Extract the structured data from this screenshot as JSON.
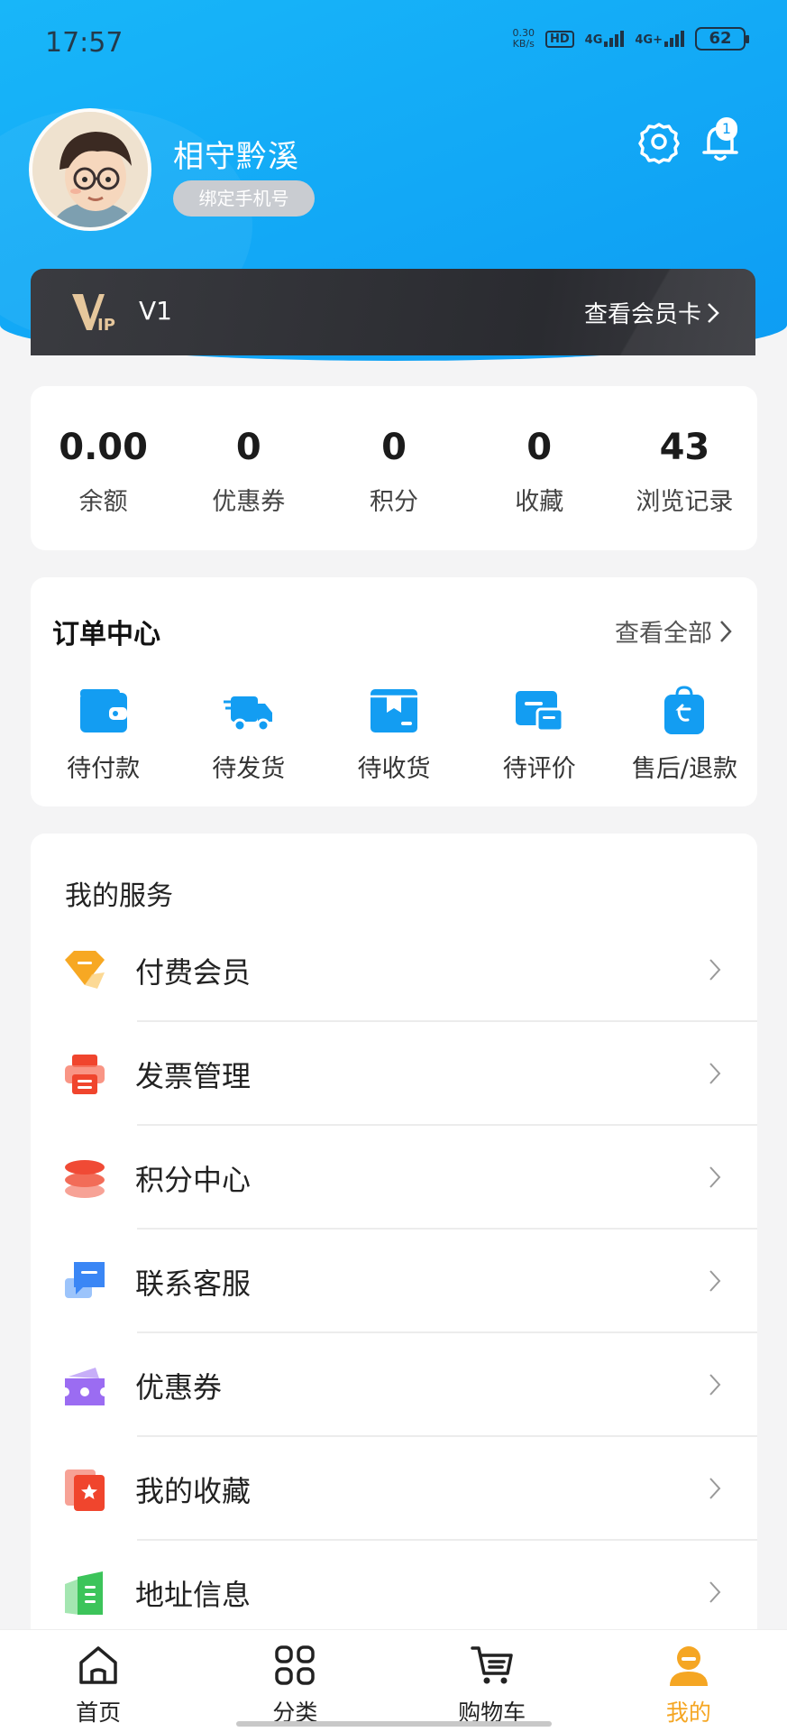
{
  "status_bar": {
    "time": "17:57",
    "net_speed_value": "0.30",
    "net_speed_unit": "KB/s",
    "hd_label": "HD",
    "signal1_label": "4G",
    "signal2_label": "4G+",
    "battery": "62"
  },
  "profile": {
    "name": "相守黔溪",
    "bind_phone_label": "绑定手机号",
    "notification_count": "1"
  },
  "vip": {
    "level": "V1",
    "link_label": "查看会员卡"
  },
  "stats": [
    {
      "value": "0.00",
      "label": "余额"
    },
    {
      "value": "0",
      "label": "优惠券"
    },
    {
      "value": "0",
      "label": "积分"
    },
    {
      "value": "0",
      "label": "收藏"
    },
    {
      "value": "43",
      "label": "浏览记录"
    }
  ],
  "orders": {
    "title": "订单中心",
    "view_all_label": "查看全部",
    "items": [
      {
        "label": "待付款",
        "icon": "wallet-icon"
      },
      {
        "label": "待发货",
        "icon": "delivery-truck-icon"
      },
      {
        "label": "待收货",
        "icon": "package-box-icon"
      },
      {
        "label": "待评价",
        "icon": "review-chat-icon"
      },
      {
        "label": "售后/退款",
        "icon": "return-bag-icon"
      }
    ]
  },
  "services": {
    "title": "我的服务",
    "items": [
      {
        "label": "付费会员",
        "icon": "diamond-icon",
        "color": "#f7a823"
      },
      {
        "label": "发票管理",
        "icon": "invoice-printer-icon",
        "color": "#f0452d"
      },
      {
        "label": "积分中心",
        "icon": "coin-stack-icon",
        "color": "#f04a35"
      },
      {
        "label": "联系客服",
        "icon": "chat-bubble-icon",
        "color": "#3a86f5"
      },
      {
        "label": "优惠券",
        "icon": "coupon-ticket-icon",
        "color": "#9b6cf2"
      },
      {
        "label": "我的收藏",
        "icon": "star-bookmark-icon",
        "color": "#f0452d"
      },
      {
        "label": "地址信息",
        "icon": "address-book-icon",
        "color": "#3cc45a"
      }
    ]
  },
  "tabbar": {
    "items": [
      {
        "label": "首页",
        "icon": "home-icon"
      },
      {
        "label": "分类",
        "icon": "category-grid-icon"
      },
      {
        "label": "购物车",
        "icon": "shopping-cart-icon"
      },
      {
        "label": "我的",
        "icon": "profile-person-icon"
      }
    ],
    "active_color": "#f5a623"
  },
  "colors": {
    "header_blue": "#0d9cf3",
    "order_icon_blue": "#139df2"
  }
}
